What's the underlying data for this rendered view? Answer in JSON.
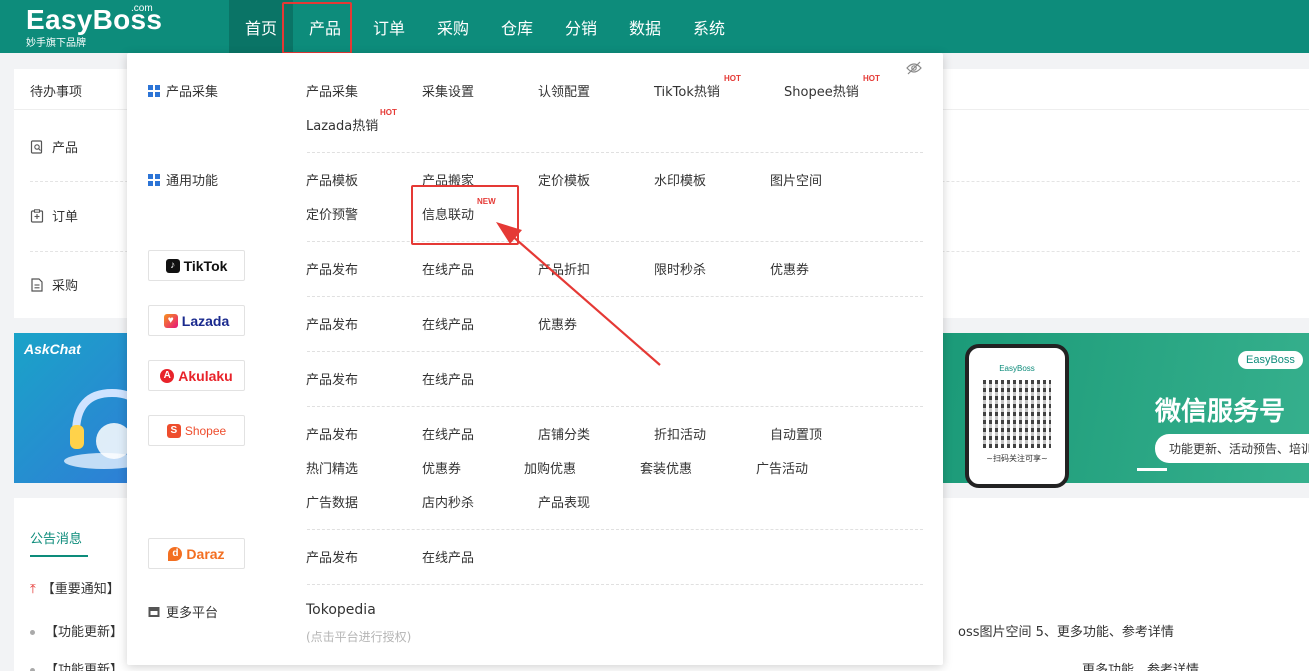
{
  "logo": {
    "brand": "EasyBoss",
    "com": ".com",
    "sub": "妙手旗下品牌"
  },
  "nav": [
    {
      "label": "首页"
    },
    {
      "label": "产品"
    },
    {
      "label": "订单"
    },
    {
      "label": "采购"
    },
    {
      "label": "仓库"
    },
    {
      "label": "分销"
    },
    {
      "label": "数据"
    },
    {
      "label": "系统"
    }
  ],
  "todo": {
    "title": "待办事项",
    "rows": [
      {
        "label": "产品"
      },
      {
        "label": "订单"
      },
      {
        "label": "采购"
      }
    ]
  },
  "banner_left": {
    "text": "AskChat"
  },
  "banner_right": {
    "brand": "EasyBoss",
    "phone_brand": "EasyBoss",
    "scan_text": "~扫码关注可享~",
    "title": "微信服务号",
    "pill": "功能更新、活动预告、培训"
  },
  "notices": {
    "tab": "公告消息",
    "rows": [
      {
        "text": "【重要通知】"
      },
      {
        "text": "【功能更新】",
        "tail": "oss图片空间 5、更多功能、参考详情"
      },
      {
        "text": "【功能更新】",
        "tail": "更多功能、参考详情"
      }
    ]
  },
  "menu": {
    "collect": {
      "title": "产品采集",
      "items": [
        "产品采集",
        "采集设置",
        "认领配置",
        "TikTok热销",
        "Shopee热销",
        "Lazada热销"
      ]
    },
    "common": {
      "title": "通用功能",
      "items": [
        "产品模板",
        "产品搬家",
        "定价模板",
        "水印模板",
        "图片空间",
        "定价预警",
        "信息联动"
      ]
    },
    "tiktok": {
      "name": "TikTok",
      "items": [
        "产品发布",
        "在线产品",
        "产品折扣",
        "限时秒杀",
        "优惠券"
      ]
    },
    "lazada": {
      "name": "Lazada",
      "items": [
        "产品发布",
        "在线产品",
        "优惠券"
      ]
    },
    "akulaku": {
      "name": "Akulaku",
      "items": [
        "产品发布",
        "在线产品"
      ]
    },
    "shopee": {
      "name": "Shopee",
      "items": [
        "产品发布",
        "在线产品",
        "店铺分类",
        "折扣活动",
        "自动置顶",
        "热门精选",
        "优惠券",
        "加购优惠",
        "套装优惠",
        "广告活动",
        "广告数据",
        "店内秒杀",
        "产品表现"
      ]
    },
    "daraz": {
      "name": "Daraz",
      "items": [
        "产品发布",
        "在线产品"
      ]
    },
    "more": {
      "title": "更多平台",
      "item": "Tokopedia",
      "sub": "(点击平台进行授权)"
    },
    "tags": {
      "hot": "HOT",
      "new": "NEW"
    }
  },
  "colors": {
    "primary": "#0d8c7b",
    "highlight": "#e53935",
    "icon_blue": "#2c74d6"
  }
}
